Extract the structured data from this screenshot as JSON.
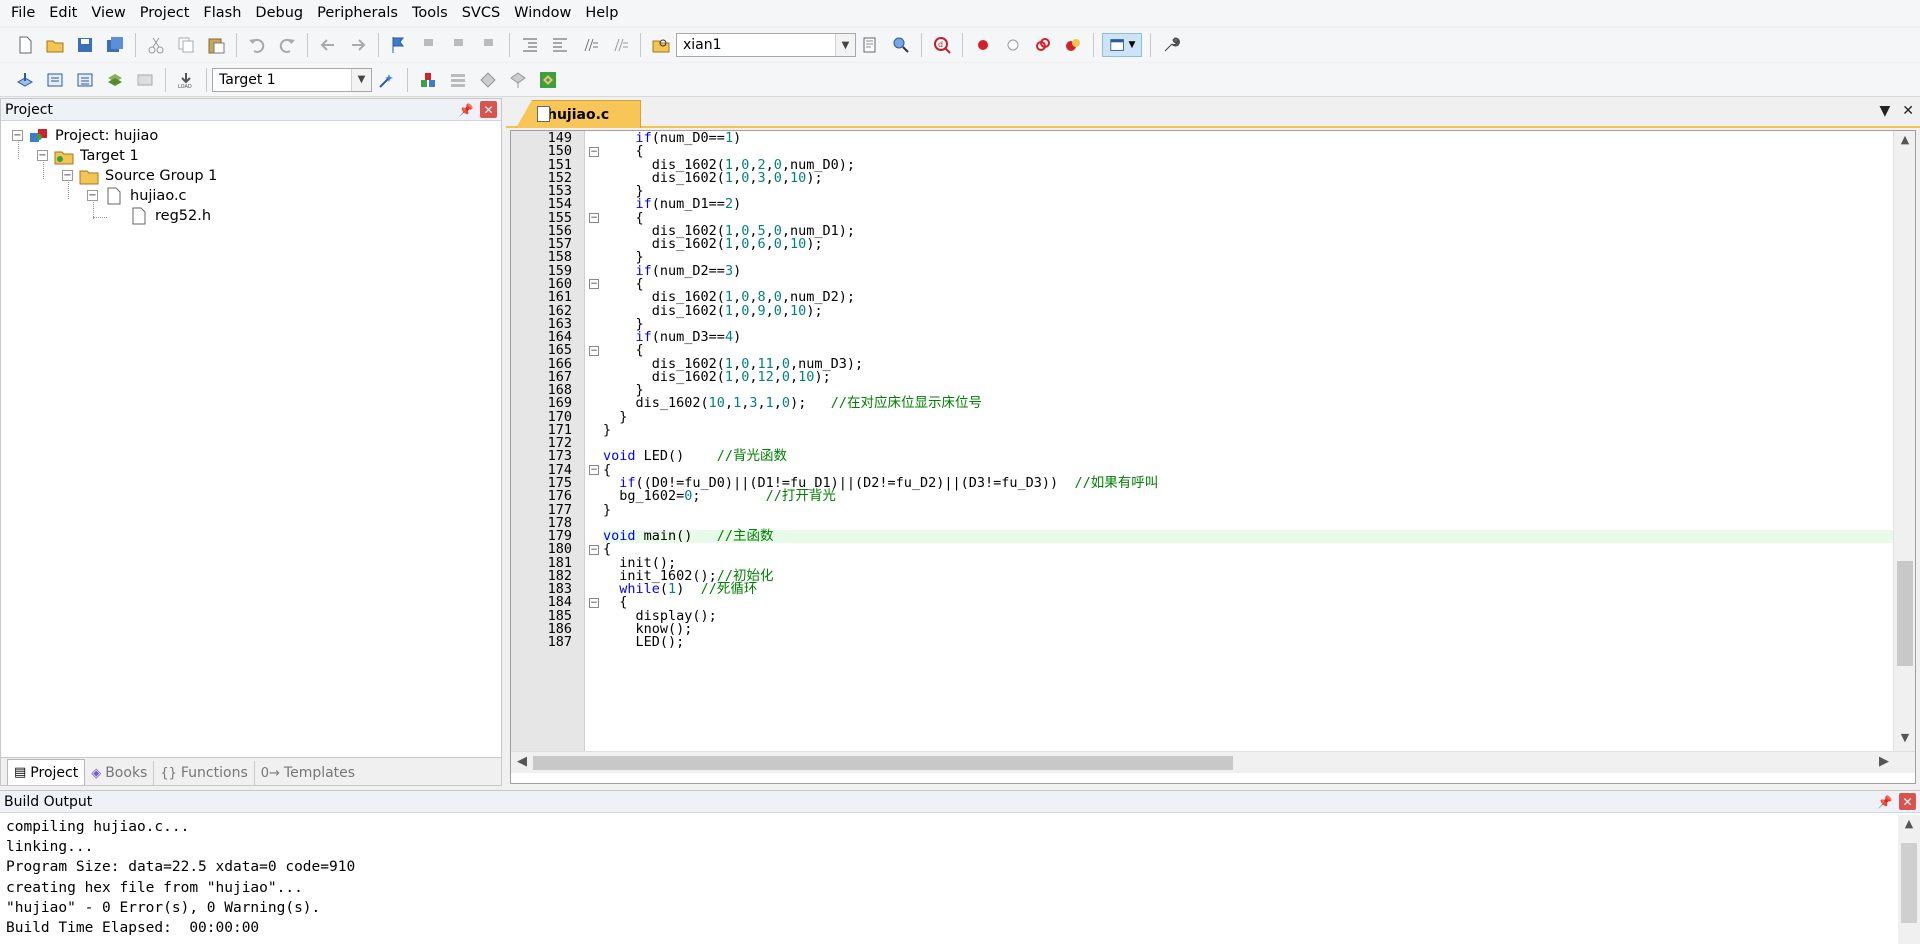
{
  "menu": [
    "File",
    "Edit",
    "View",
    "Project",
    "Flash",
    "Debug",
    "Peripherals",
    "Tools",
    "SVCS",
    "Window",
    "Help"
  ],
  "toolbar1": {
    "find_value": "xian1"
  },
  "toolbar2": {
    "target_value": "Target 1"
  },
  "project_pane": {
    "title": "Project",
    "tree": {
      "project": "Project: hujiao",
      "target": "Target 1",
      "group": "Source Group 1",
      "file": "hujiao.c",
      "include": "reg52.h"
    },
    "tabs": [
      "Project",
      "Books",
      "Functions",
      "Templates"
    ]
  },
  "editor": {
    "tab_label": "hujiao.c",
    "lines": [
      {
        "n": "149",
        "fold": "",
        "html": "    <span class=\"kw\">if</span>(num_D0==<span class=\"num\">1</span>)"
      },
      {
        "n": "150",
        "fold": "⊟",
        "html": "    {"
      },
      {
        "n": "151",
        "fold": "",
        "html": "      dis_1602(<span class=\"num\">1</span>,<span class=\"num\">0</span>,<span class=\"num\">2</span>,<span class=\"num\">0</span>,num_D0);"
      },
      {
        "n": "152",
        "fold": "",
        "html": "      dis_1602(<span class=\"num\">1</span>,<span class=\"num\">0</span>,<span class=\"num\">3</span>,<span class=\"num\">0</span>,<span class=\"num\">10</span>);"
      },
      {
        "n": "153",
        "fold": "",
        "html": "    }"
      },
      {
        "n": "154",
        "fold": "",
        "html": "    <span class=\"kw\">if</span>(num_D1==<span class=\"num\">2</span>)"
      },
      {
        "n": "155",
        "fold": "⊟",
        "html": "    {"
      },
      {
        "n": "156",
        "fold": "",
        "html": "      dis_1602(<span class=\"num\">1</span>,<span class=\"num\">0</span>,<span class=\"num\">5</span>,<span class=\"num\">0</span>,num_D1);"
      },
      {
        "n": "157",
        "fold": "",
        "html": "      dis_1602(<span class=\"num\">1</span>,<span class=\"num\">0</span>,<span class=\"num\">6</span>,<span class=\"num\">0</span>,<span class=\"num\">10</span>);"
      },
      {
        "n": "158",
        "fold": "",
        "html": "    }"
      },
      {
        "n": "159",
        "fold": "",
        "html": "    <span class=\"kw\">if</span>(num_D2==<span class=\"num\">3</span>)"
      },
      {
        "n": "160",
        "fold": "⊟",
        "html": "    {"
      },
      {
        "n": "161",
        "fold": "",
        "html": "      dis_1602(<span class=\"num\">1</span>,<span class=\"num\">0</span>,<span class=\"num\">8</span>,<span class=\"num\">0</span>,num_D2);"
      },
      {
        "n": "162",
        "fold": "",
        "html": "      dis_1602(<span class=\"num\">1</span>,<span class=\"num\">0</span>,<span class=\"num\">9</span>,<span class=\"num\">0</span>,<span class=\"num\">10</span>);"
      },
      {
        "n": "163",
        "fold": "",
        "html": "    }"
      },
      {
        "n": "164",
        "fold": "",
        "html": "    <span class=\"kw\">if</span>(num_D3==<span class=\"num\">4</span>)"
      },
      {
        "n": "165",
        "fold": "⊟",
        "html": "    {"
      },
      {
        "n": "166",
        "fold": "",
        "html": "      dis_1602(<span class=\"num\">1</span>,<span class=\"num\">0</span>,<span class=\"num\">11</span>,<span class=\"num\">0</span>,num_D3);"
      },
      {
        "n": "167",
        "fold": "",
        "html": "      dis_1602(<span class=\"num\">1</span>,<span class=\"num\">0</span>,<span class=\"num\">12</span>,<span class=\"num\">0</span>,<span class=\"num\">10</span>);"
      },
      {
        "n": "168",
        "fold": "",
        "html": "    }"
      },
      {
        "n": "169",
        "fold": "",
        "html": "    dis_1602(<span class=\"num\">10</span>,<span class=\"num\">1</span>,<span class=\"num\">3</span>,<span class=\"num\">1</span>,<span class=\"num\">0</span>);   <span class=\"cm\">//在对应床位显示床位号</span>"
      },
      {
        "n": "170",
        "fold": "",
        "html": "  }"
      },
      {
        "n": "171",
        "fold": "",
        "html": "}"
      },
      {
        "n": "172",
        "fold": "",
        "html": ""
      },
      {
        "n": "173",
        "fold": "",
        "html": "<span class=\"kw\">void</span> LED()    <span class=\"cm\">//背光函数</span>"
      },
      {
        "n": "174",
        "fold": "⊟",
        "html": "{"
      },
      {
        "n": "175",
        "fold": "",
        "html": "  <span class=\"kw\">if</span>((D0!=fu_D0)||(D1!=fu_D1)||(D2!=fu_D2)||(D3!=fu_D3))  <span class=\"cm\">//如果有呼叫</span>"
      },
      {
        "n": "176",
        "fold": "",
        "html": "  bg_1602=<span class=\"num\">0</span>;        <span class=\"cm\">//打开背光</span>"
      },
      {
        "n": "177",
        "fold": "",
        "html": "}"
      },
      {
        "n": "178",
        "fold": "",
        "html": ""
      },
      {
        "n": "179",
        "fold": "",
        "html": "<span class=\"kw\">void</span> main()   <span class=\"cm\">//主函数</span>",
        "hl": true
      },
      {
        "n": "180",
        "fold": "⊟",
        "html": "{"
      },
      {
        "n": "181",
        "fold": "",
        "html": "  init();"
      },
      {
        "n": "182",
        "fold": "",
        "html": "  init_1602();<span class=\"cm\">//初始化</span>"
      },
      {
        "n": "183",
        "fold": "",
        "html": "  <span class=\"kw\">while</span>(<span class=\"num\">1</span>)  <span class=\"cm\">//死循环</span>"
      },
      {
        "n": "184",
        "fold": "⊟",
        "html": "  {"
      },
      {
        "n": "185",
        "fold": "",
        "html": "    display();"
      },
      {
        "n": "186",
        "fold": "",
        "html": "    know();"
      },
      {
        "n": "187",
        "fold": "",
        "html": "    LED();"
      }
    ]
  },
  "build_output": {
    "title": "Build Output",
    "lines": "compiling hujiao.c...\nlinking...\nProgram Size: data=22.5 xdata=0 code=910\ncreating hex file from \"hujiao\"...\n\"hujiao\" - 0 Error(s), 0 Warning(s).\nBuild Time Elapsed:  00:00:00"
  }
}
